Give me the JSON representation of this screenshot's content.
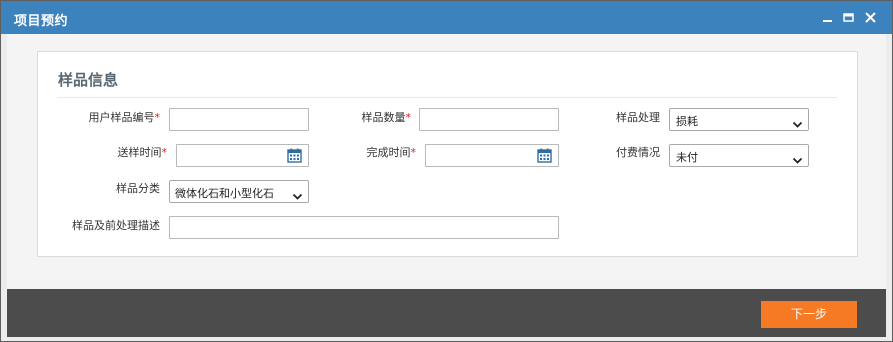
{
  "window": {
    "title": "项目预约"
  },
  "section": {
    "title": "样品信息"
  },
  "fields": {
    "user_sample_no": {
      "label": "用户样品编号",
      "required_mark": "*",
      "value": ""
    },
    "sample_quantity": {
      "label": "样品数量",
      "required_mark": "*",
      "value": ""
    },
    "sample_handling": {
      "label": "样品处理",
      "selected": "损耗"
    },
    "send_time": {
      "label": "送样时间",
      "required_mark": "*",
      "value": ""
    },
    "finish_time": {
      "label": "完成时间",
      "required_mark": "*",
      "value": ""
    },
    "payment_status": {
      "label": "付费情况",
      "selected": "未付"
    },
    "sample_category": {
      "label": "样品分类",
      "selected": "微体化石和小型化石"
    },
    "pretreatment_desc": {
      "label": "样品及前处理描述",
      "value": ""
    }
  },
  "footer": {
    "next_label": "下一步"
  },
  "colors": {
    "titlebar": "#3c82bd",
    "accent_button": "#f57a23",
    "footer": "#4c4c4c",
    "required": "#d61f1f"
  },
  "icons": {
    "minimize": "minimize-icon",
    "maximize": "maximize-icon",
    "close": "close-icon",
    "calendar": "calendar-icon",
    "dropdown": "chevron-down-icon"
  }
}
